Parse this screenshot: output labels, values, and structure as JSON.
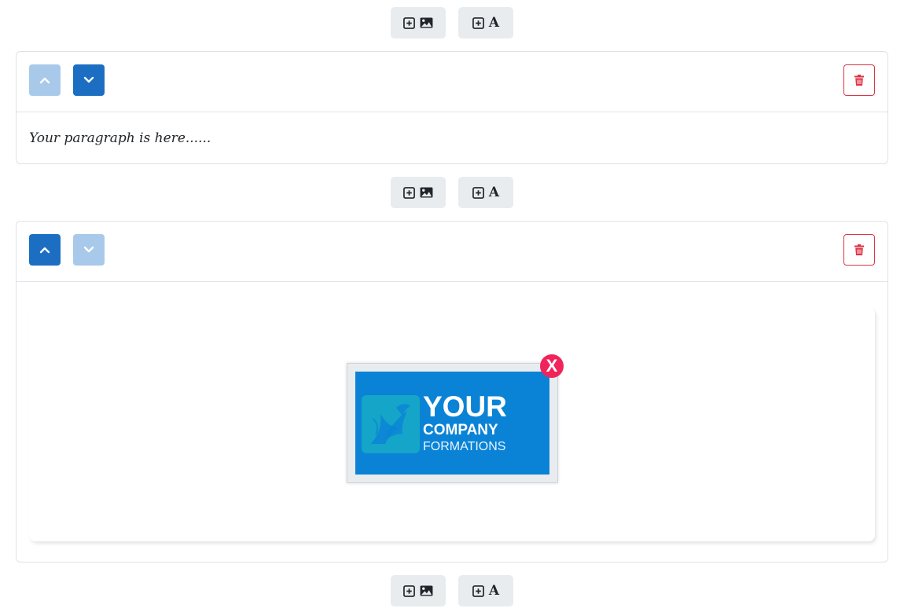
{
  "toolbar": {
    "add_image_icon": "plus-square-image-icon",
    "add_text_icon": "plus-square-text-icon",
    "add_text_glyph": "A"
  },
  "blocks": [
    {
      "type": "paragraph",
      "paragraph_text": "Your paragraph is here......",
      "move_up_enabled": false,
      "move_down_enabled": true
    },
    {
      "type": "image",
      "move_up_enabled": true,
      "move_down_enabled": false,
      "logo": {
        "line1": "YOUR",
        "line2": "COMPANY",
        "line3": "FORMATIONS"
      },
      "remove_label": "X"
    }
  ],
  "colors": {
    "primary": "#1b6ec2",
    "primary_disabled": "#a9c9ea",
    "danger": "#dc3545",
    "remove": "#f0245a",
    "logo_bg": "#0a83d6",
    "button_bg": "#e9ecef"
  }
}
